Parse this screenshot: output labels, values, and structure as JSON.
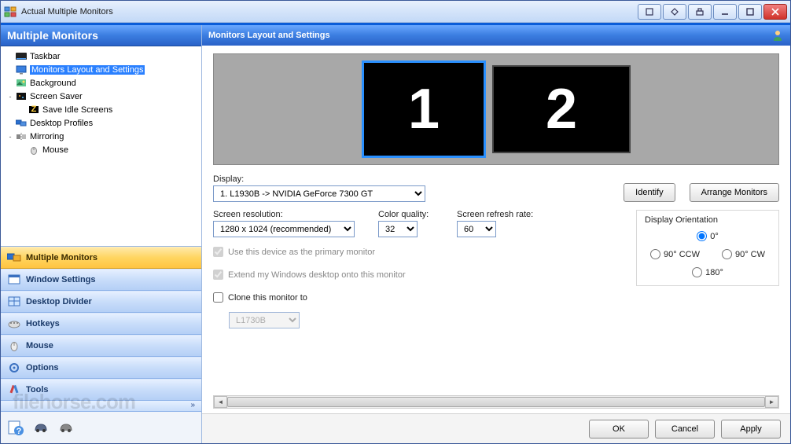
{
  "window": {
    "title": "Actual Multiple Monitors"
  },
  "left_panel": {
    "header": "Multiple Monitors",
    "tree": [
      {
        "label": "Taskbar",
        "depth": 0,
        "icon": "taskbar"
      },
      {
        "label": "Monitors Layout and Settings",
        "depth": 0,
        "icon": "monitor",
        "selected": true
      },
      {
        "label": "Background",
        "depth": 0,
        "icon": "background"
      },
      {
        "label": "Screen Saver",
        "depth": 0,
        "icon": "screensaver",
        "expander": "-"
      },
      {
        "label": "Save Idle Screens",
        "depth": 1,
        "icon": "idle"
      },
      {
        "label": "Desktop Profiles",
        "depth": 0,
        "icon": "profiles"
      },
      {
        "label": "Mirroring",
        "depth": 0,
        "icon": "mirror",
        "expander": "-"
      },
      {
        "label": "Mouse",
        "depth": 1,
        "icon": "mouse"
      }
    ],
    "nav": [
      {
        "label": "Multiple Monitors",
        "icon": "monitors",
        "active": true
      },
      {
        "label": "Window Settings",
        "icon": "window"
      },
      {
        "label": "Desktop Divider",
        "icon": "divider"
      },
      {
        "label": "Hotkeys",
        "icon": "hotkeys"
      },
      {
        "label": "Mouse",
        "icon": "mouse"
      },
      {
        "label": "Options",
        "icon": "options"
      },
      {
        "label": "Tools",
        "icon": "tools"
      }
    ]
  },
  "right_panel": {
    "header": "Monitors Layout and Settings",
    "monitors": [
      "1",
      "2"
    ],
    "display_label": "Display:",
    "display_value": "1. L1930B -> NVIDIA GeForce 7300 GT",
    "identify_btn": "Identify",
    "arrange_btn": "Arrange Monitors",
    "resolution_label": "Screen resolution:",
    "resolution_value": "1280 x 1024 (recommended)",
    "color_label": "Color quality:",
    "color_value": "32",
    "refresh_label": "Screen refresh rate:",
    "refresh_value": "60",
    "primary_chk": "Use this device as the primary monitor",
    "extend_chk": "Extend my Windows desktop onto this monitor",
    "clone_chk": "Clone this monitor to",
    "clone_target": "L1730B",
    "orientation": {
      "title": "Display Orientation",
      "o0": "0°",
      "o90ccw": "90° CCW",
      "o90cw": "90° CW",
      "o180": "180°"
    }
  },
  "footer": {
    "ok": "OK",
    "cancel": "Cancel",
    "apply": "Apply"
  },
  "watermark": "filehorse.com"
}
